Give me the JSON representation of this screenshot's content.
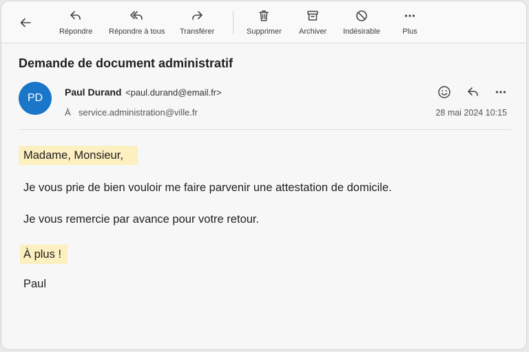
{
  "toolbar": {
    "back_icon": "arrow-left-icon",
    "actions": [
      {
        "label": "Répondre",
        "icon": "reply-icon"
      },
      {
        "label": "Répondre à tous",
        "icon": "reply-all-icon"
      },
      {
        "label": "Transférer",
        "icon": "forward-icon"
      },
      {
        "label": "Supprimer",
        "icon": "trash-icon"
      },
      {
        "label": "Archiver",
        "icon": "archive-icon"
      },
      {
        "label": "Indésirable",
        "icon": "block-icon"
      },
      {
        "label": "Plus",
        "icon": "more-horizontal-icon"
      }
    ]
  },
  "message": {
    "subject": "Demande de document administratif",
    "avatar_initials": "PD",
    "avatar_color": "#1976c8",
    "sender_name": "Paul Durand",
    "sender_email": "<paul.durand@email.fr>",
    "to_prefix": "À",
    "to_address": "service.administration@ville.fr",
    "date": "28 mai 2024 10:15",
    "header_actions": [
      "emoji-icon",
      "reply-icon",
      "more-horizontal-icon"
    ]
  },
  "body": {
    "greeting": "Madame, Monsieur,",
    "line1": "Je vous prie de bien vouloir me faire parvenir une attestation de domicile.",
    "line2": "Je vous remercie par avance pour votre retour.",
    "closing": "À plus !",
    "signature": "Paul",
    "highlight_color": "#fcefc0"
  }
}
